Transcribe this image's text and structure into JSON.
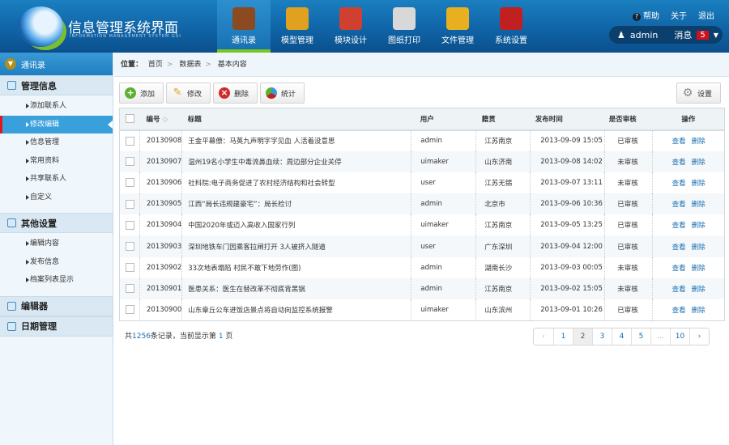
{
  "app": {
    "title": "信息管理系统界面",
    "subtitle": "INFORMATION MANAGEMENT SYSTEM GUI"
  },
  "nav": [
    {
      "label": "通讯录",
      "icon": "book-icon",
      "color": "#8b4a1f"
    },
    {
      "label": "模型管理",
      "icon": "ruler-icon",
      "color": "#e0a020"
    },
    {
      "label": "模块设计",
      "icon": "tools-icon",
      "color": "#d04030"
    },
    {
      "label": "图纸打印",
      "icon": "printer-icon",
      "color": "#d8d8d8"
    },
    {
      "label": "文件管理",
      "icon": "folder-icon",
      "color": "#e8b020"
    },
    {
      "label": "系统设置",
      "icon": "wrench-icon",
      "color": "#c02020"
    }
  ],
  "topright": {
    "help": "帮助",
    "about": "关于",
    "logout": "退出",
    "user": "admin",
    "messages": "消息",
    "msg_count": "5"
  },
  "sidebar": {
    "title": "通讯录",
    "sections": [
      {
        "label": "管理信息",
        "items": [
          "添加联系人",
          "修改编辑",
          "信息管理",
          "常用资料",
          "共享联系人",
          "自定义"
        ]
      },
      {
        "label": "其他设置",
        "items": [
          "编辑内容",
          "发布信息",
          "档案列表显示"
        ]
      },
      {
        "label": "编辑器",
        "items": []
      },
      {
        "label": "日期管理",
        "items": []
      }
    ]
  },
  "breadcrumb": {
    "label": "位置：",
    "items": [
      "首页",
      "数据表",
      "基本内容"
    ]
  },
  "toolbar": {
    "add": "添加",
    "edit": "修改",
    "delete": "删除",
    "stats": "统计",
    "settings": "设置"
  },
  "table": {
    "headers": [
      "编号",
      "标题",
      "用户",
      "籍贯",
      "发布时间",
      "是否审核",
      "操作"
    ],
    "sort_icon": "◇",
    "view": "查看",
    "del": "删除",
    "rows": [
      [
        "20130908",
        "王金平幕僚：马英九声明字字见血 人活着没意思",
        "admin",
        "江苏南京",
        "2013-09-09 15:05",
        "已审核"
      ],
      [
        "20130907",
        "温州19名小学生中毒流鼻血续：周边部分企业关停",
        "uimaker",
        "山东济南",
        "2013-09-08 14:02",
        "未审核"
      ],
      [
        "20130906",
        "社科院:电子商务促进了农村经济结构和社会转型",
        "user",
        "江苏无锡",
        "2013-09-07 13:11",
        "未审核"
      ],
      [
        "20130905",
        "江西“局长违规建豪宅”：局长检讨",
        "admin",
        "北京市",
        "2013-09-06 10:36",
        "已审核"
      ],
      [
        "20130904",
        "中国2020年或迈入高收入国家行列",
        "uimaker",
        "江苏南京",
        "2013-09-05 13:25",
        "已审核"
      ],
      [
        "20130903",
        "深圳地铁车门因乘客拉闸打开 3人被挤入隧道",
        "user",
        "广东深圳",
        "2013-09-04 12:00",
        "已审核"
      ],
      [
        "20130902",
        "33次地表塌陷 村民不敢下地劳作(图)",
        "admin",
        "湖南长沙",
        "2013-09-03 00:05",
        "未审核"
      ],
      [
        "20130901",
        "医患关系：医生在替改革不彻底背黑锅",
        "admin",
        "江苏南京",
        "2013-09-02 15:05",
        "未审核"
      ],
      [
        "20130900",
        "山东章丘公车进饭店景点将自动向监控系统报警",
        "uimaker",
        "山东滨州",
        "2013-09-01 10:26",
        "已审核"
      ]
    ]
  },
  "footer": {
    "prefix": "共",
    "total": "1256",
    "mid": "条记录，当前显示第",
    "page": "1",
    "suffix": "页"
  },
  "pagination": [
    "‹",
    "1",
    "2",
    "3",
    "4",
    "5",
    "...",
    "10",
    "›"
  ]
}
